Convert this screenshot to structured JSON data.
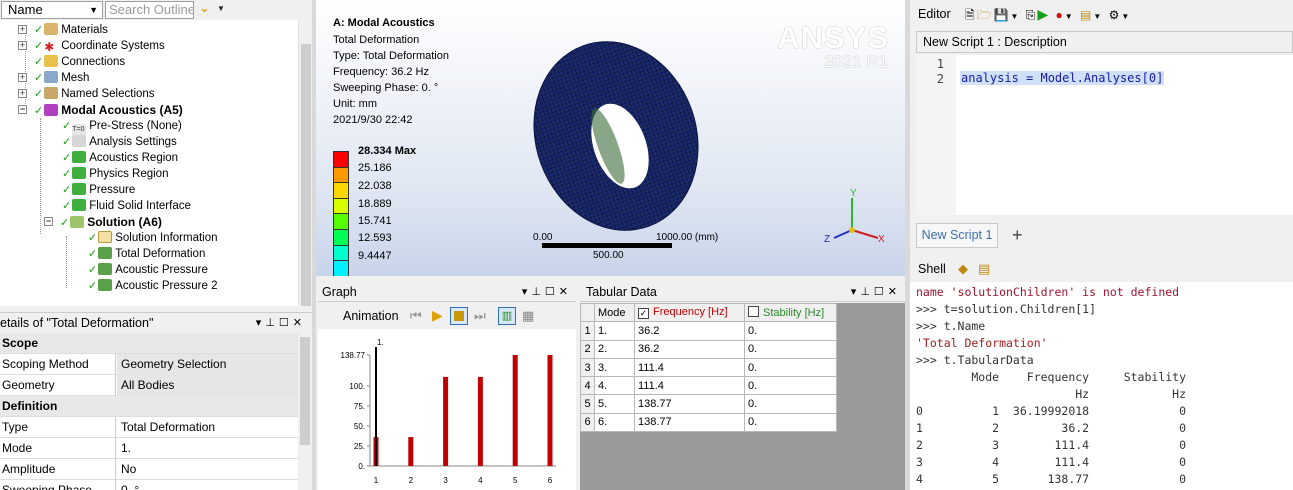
{
  "outline": {
    "name_dropdown": "Name",
    "search_placeholder": "Search Outline",
    "items": [
      {
        "label": "Materials"
      },
      {
        "label": "Coordinate Systems"
      },
      {
        "label": "Connections"
      },
      {
        "label": "Mesh"
      },
      {
        "label": "Named Selections"
      },
      {
        "label": "Modal Acoustics (A5)"
      },
      {
        "label": "Pre-Stress (None)"
      },
      {
        "label": "Analysis Settings"
      },
      {
        "label": "Acoustics Region"
      },
      {
        "label": "Physics Region"
      },
      {
        "label": "Pressure"
      },
      {
        "label": "Fluid Solid Interface"
      },
      {
        "label": "Solution (A6)"
      },
      {
        "label": "Solution Information"
      },
      {
        "label": "Total Deformation"
      },
      {
        "label": "Acoustic Pressure"
      },
      {
        "label": "Acoustic Pressure 2"
      }
    ]
  },
  "details": {
    "title": "etails of \"Total Deformation\"",
    "rows": [
      {
        "key": "Scope",
        "value": ""
      },
      {
        "key": "Scoping Method",
        "value": "Geometry Selection"
      },
      {
        "key": "Geometry",
        "value": "All Bodies"
      },
      {
        "key": "Definition",
        "value": ""
      },
      {
        "key": "Type",
        "value": "Total Deformation"
      },
      {
        "key": "Mode",
        "value": "1."
      },
      {
        "key": "Amplitude",
        "value": "No"
      },
      {
        "key": "Sweeping Phase",
        "value": "0. °"
      }
    ]
  },
  "viewport": {
    "title": "A: Modal Acoustics",
    "lines": [
      "Total Deformation",
      "Type: Total Deformation",
      "Frequency: 36.2 Hz",
      "Sweeping Phase: 0. °",
      "Unit: mm",
      "2021/9/30 22:42"
    ],
    "logo": "ANSYS",
    "version": "2021 R1",
    "legend_max": "28.334 Max",
    "legend_values": [
      "25.186",
      "22.038",
      "18.889",
      "15.741",
      "12.593",
      "9.4447"
    ],
    "legend_colors": [
      "#ff0000",
      "#ff9900",
      "#ffd700",
      "#d8ff00",
      "#55ff00",
      "#00ff55",
      "#00ffcc",
      "#00f0ff"
    ],
    "scale_left": "0.00",
    "scale_right": "1000.00 (mm)",
    "scale_mid": "500.00",
    "triad_y": "Y",
    "triad_z": "Z",
    "triad_x": "X"
  },
  "graph": {
    "title": "Graph",
    "animation_label": "Animation"
  },
  "chart_data": {
    "type": "bar",
    "categories": [
      "1",
      "2",
      "3",
      "4",
      "5",
      "6"
    ],
    "values": [
      36.2,
      36.2,
      111.4,
      111.4,
      138.77,
      138.77
    ],
    "ytick_labels": [
      "0.",
      "25.",
      "50.",
      "75.",
      "100.",
      "138.77"
    ],
    "ytick_values": [
      0,
      25,
      50,
      75,
      100,
      138.77
    ],
    "marker_label": "1.",
    "ylim": [
      0,
      138.77
    ],
    "bar_color": "#c00000"
  },
  "tabular": {
    "title": "Tabular Data",
    "headers": [
      "Mode",
      "Frequency [Hz]",
      "Stability [Hz]"
    ],
    "rows": [
      [
        "1",
        "1.",
        "36.2",
        "0."
      ],
      [
        "2",
        "2.",
        "36.2",
        "0."
      ],
      [
        "3",
        "3.",
        "111.4",
        "0."
      ],
      [
        "4",
        "4.",
        "111.4",
        "0."
      ],
      [
        "5",
        "5.",
        "138.77",
        "0."
      ],
      [
        "6",
        "6.",
        "138.77",
        "0."
      ]
    ]
  },
  "editor": {
    "title": "Editor",
    "description": "New Script 1 : Description",
    "line_numbers": [
      "1",
      "2"
    ],
    "code_line": "analysis = Model.Analyses[0]",
    "tab_label": "New Script 1",
    "add_tab": "+"
  },
  "shell": {
    "title": "Shell",
    "lines": [
      {
        "cls": "err",
        "text": "name 'solutionChildren' is not defined"
      },
      {
        "cls": "prompt",
        "text": ">>> t=solution.Children[1]"
      },
      {
        "cls": "prompt",
        "text": ">>> t.Name"
      },
      {
        "cls": "str",
        "text": "'Total Deformation'"
      },
      {
        "cls": "prompt",
        "text": ">>> t.TabularData"
      },
      {
        "cls": "out",
        "text": "        Mode    Frequency     Stability"
      },
      {
        "cls": "out",
        "text": "                       Hz            Hz"
      },
      {
        "cls": "out",
        "text": "0          1  36.19992018             0"
      },
      {
        "cls": "out",
        "text": "1          2         36.2             0"
      },
      {
        "cls": "out",
        "text": "2          3        111.4             0"
      },
      {
        "cls": "out",
        "text": "3          4        111.4             0"
      },
      {
        "cls": "out",
        "text": "4          5       138.77             0"
      }
    ]
  }
}
